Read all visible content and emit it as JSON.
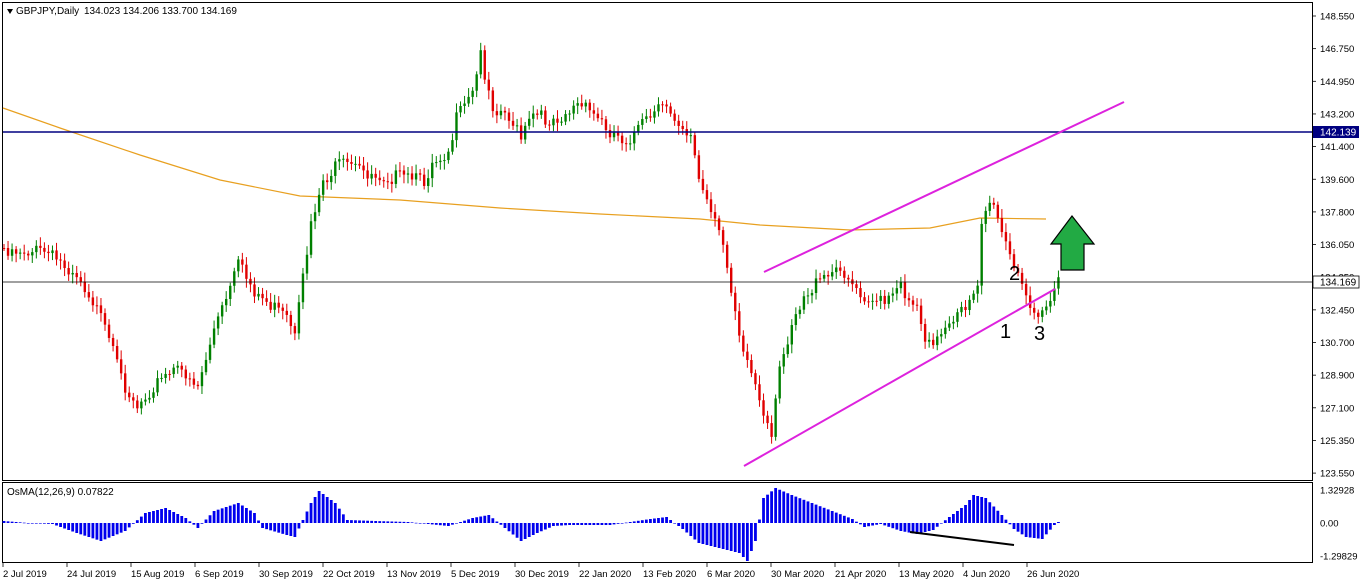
{
  "header": {
    "symbol": "GBPJPY,Daily",
    "ohlc": "134.023 134.206 133.700 134.169"
  },
  "indicator": {
    "label": "OsMA(12,26,9) 0.07822",
    "axis_labels": [
      "1.32928",
      "0.00",
      "-1.29829"
    ]
  },
  "price_axis": {
    "labels": [
      "148.550",
      "146.750",
      "144.950",
      "143.200",
      "141.400",
      "139.600",
      "137.800",
      "136.050",
      "134.250",
      "132.450",
      "130.700",
      "128.900",
      "127.100",
      "125.350",
      "123.550"
    ],
    "marker_hline": "142.139",
    "marker_current": "134.169"
  },
  "time_axis": {
    "labels": [
      "2 Jul 2019",
      "24 Jul 2019",
      "15 Aug 2019",
      "6 Sep 2019",
      "30 Sep 2019",
      "22 Oct 2019",
      "13 Nov 2019",
      "5 Dec 2019",
      "30 Dec 2019",
      "22 Jan 2020",
      "13 Feb 2020",
      "6 Mar 2020",
      "30 Mar 2020",
      "21 Apr 2020",
      "13 May 2020",
      "4 Jun 2020",
      "26 Jun 2020"
    ]
  },
  "annotations": [
    "1",
    "2",
    "3"
  ],
  "colors": {
    "bull": "#008000",
    "bear": "#e00000",
    "ma": "#e8a020",
    "channel": "#dd22dd",
    "hline": "#000080",
    "osma": "#0000ee",
    "arrow": "#22aa44"
  },
  "chart_data": {
    "type": "candlestick",
    "symbol": "GBPJPY",
    "timeframe": "Daily",
    "ylim": [
      123.55,
      148.55
    ],
    "horizontal_line": 142.139,
    "current_price": 134.169,
    "ohlc_last": {
      "open": 134.023,
      "high": 134.206,
      "low": 133.7,
      "close": 134.169
    },
    "approx_closes_by_date": {
      "2 Jul 2019": 135.5,
      "24 Jul 2019": 134.8,
      "15 Aug 2019": 128.0,
      "6 Sep 2019": 131.5,
      "30 Sep 2019": 133.0,
      "22 Oct 2019": 140.0,
      "13 Nov 2019": 140.4,
      "5 Dec 2019": 143.5,
      "30 Dec 2019": 143.2,
      "22 Jan 2020": 143.0,
      "13 Feb 2020": 143.5,
      "6 Mar 2020": 134.5,
      "30 Mar 2020": 133.5,
      "21 Apr 2020": 133.0,
      "13 May 2020": 131.0,
      "4 Jun 2020": 138.0,
      "26 Jun 2020": 133.5
    },
    "oscillator": {
      "name": "OsMA(12,26,9)",
      "value": 0.07822,
      "ylim": [
        -1.29829,
        1.32928
      ]
    }
  }
}
